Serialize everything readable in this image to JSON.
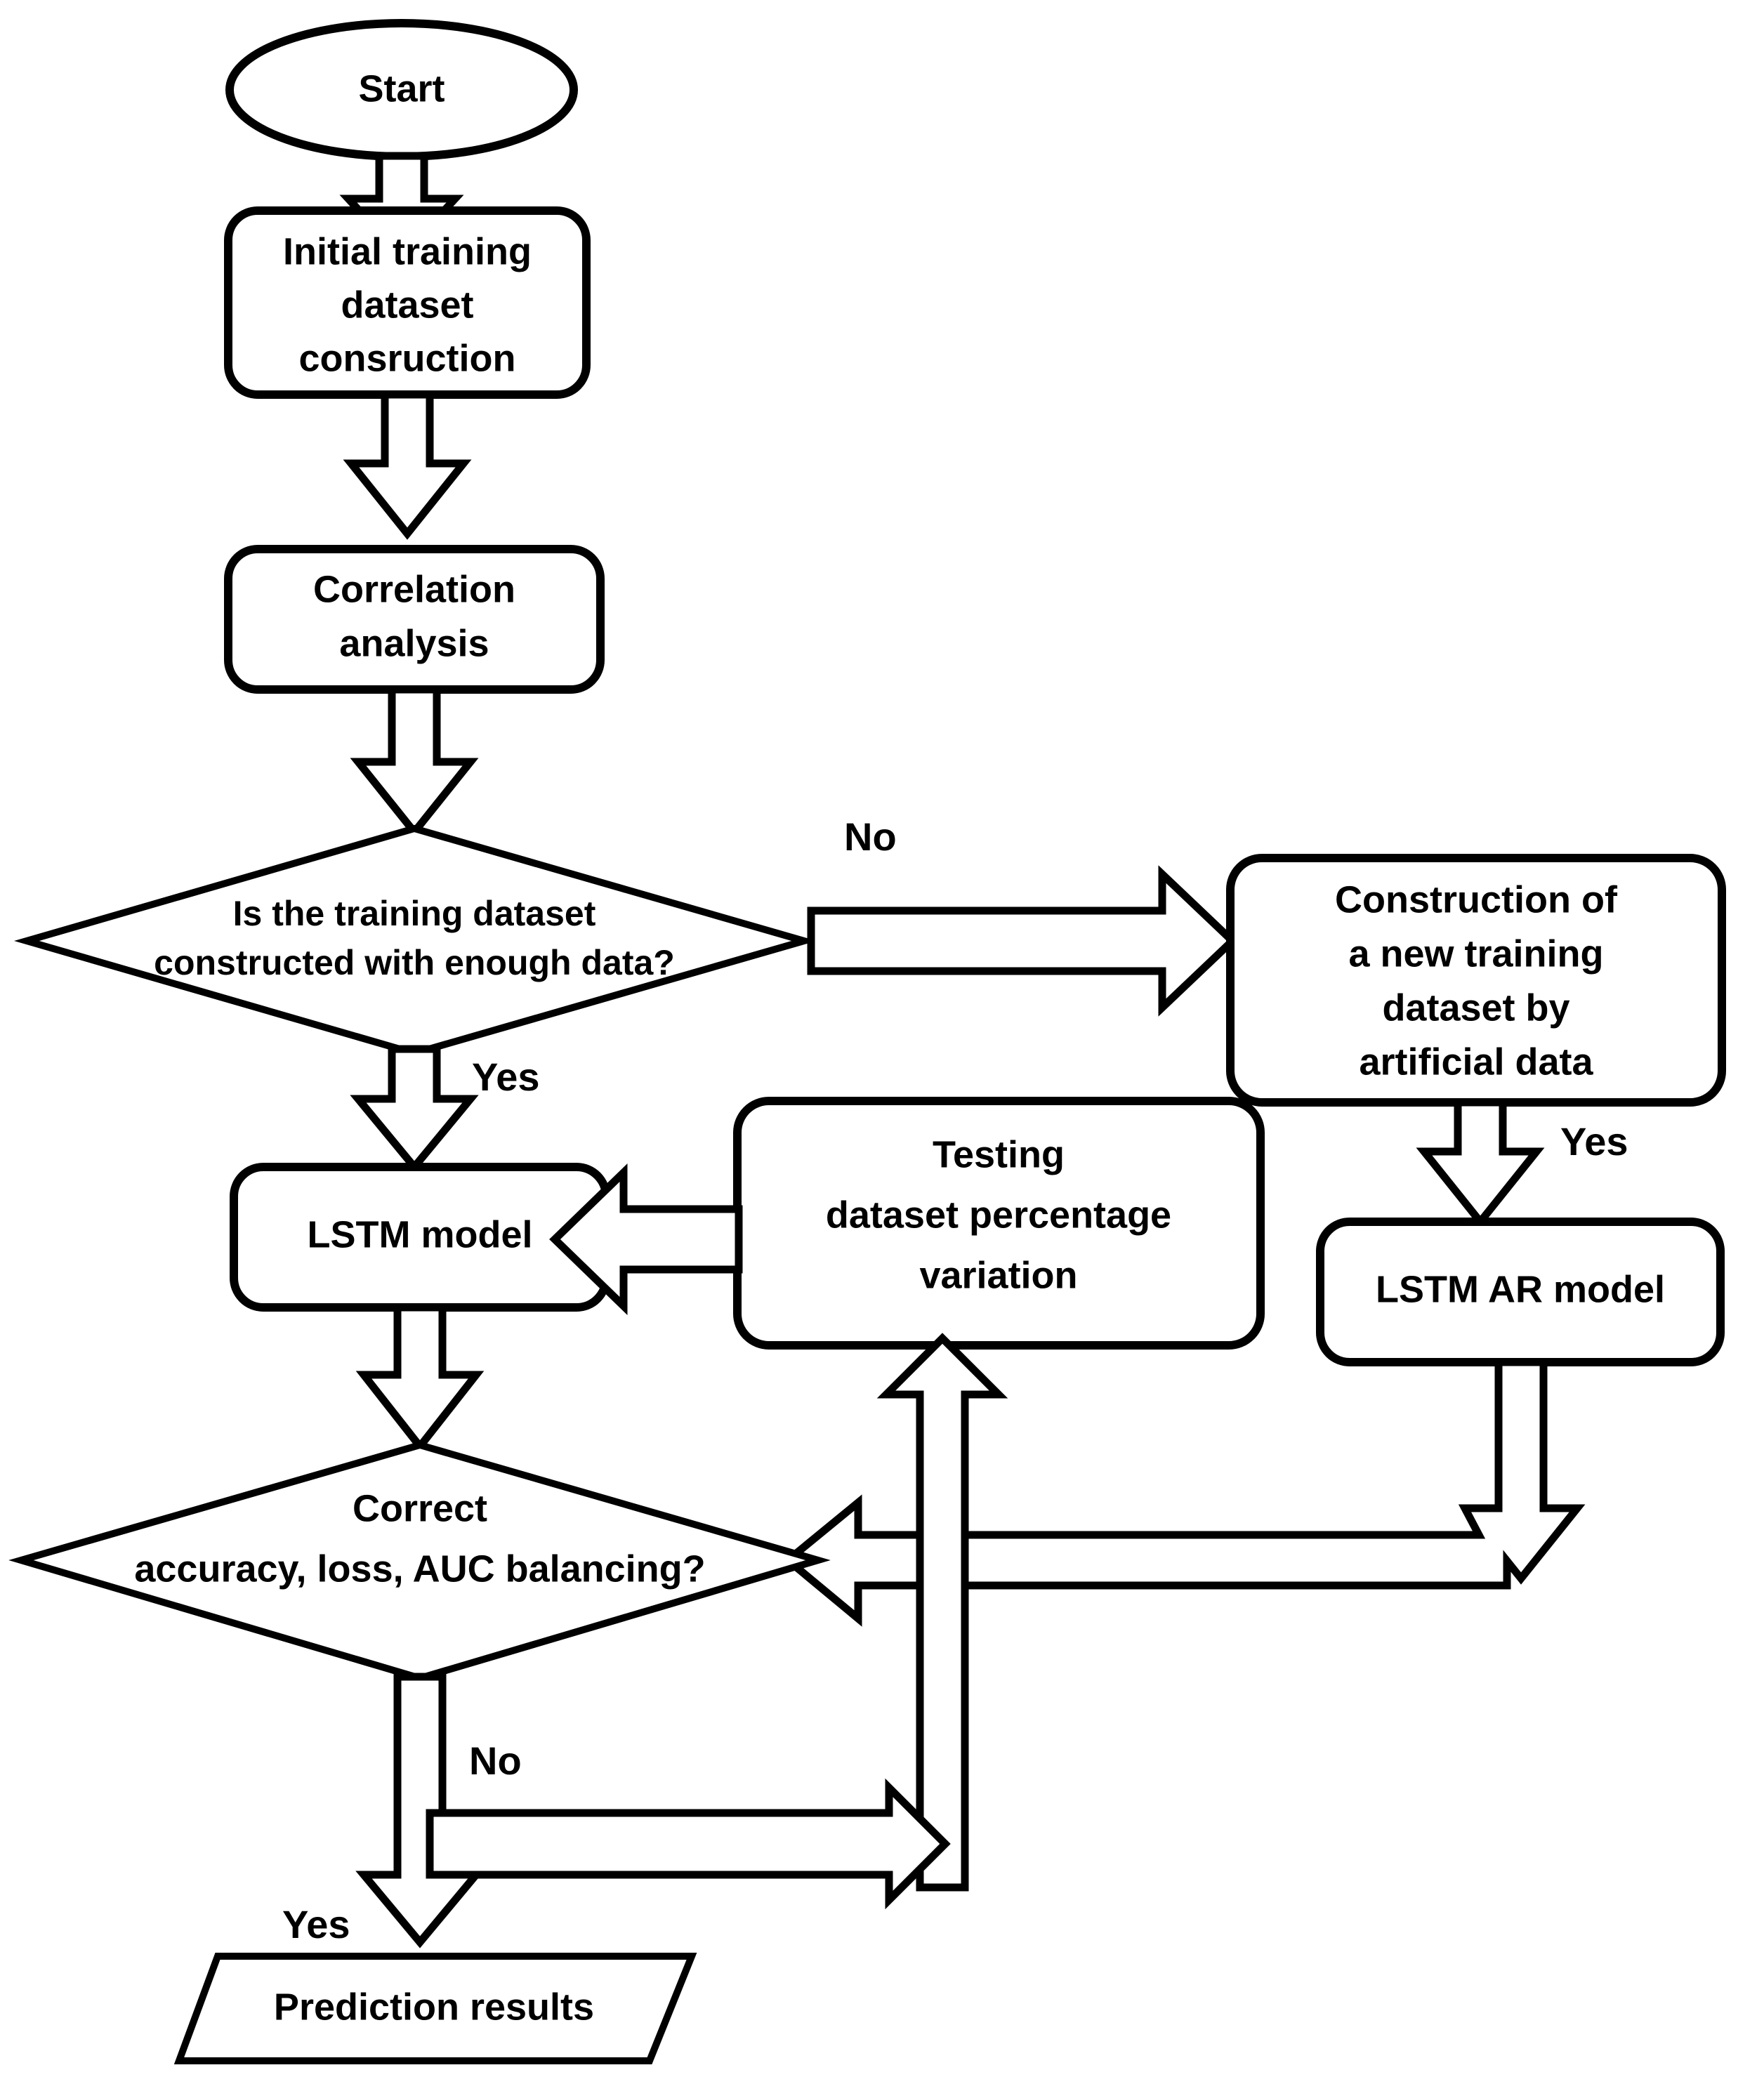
{
  "diagram": {
    "title": "LSTM prediction workflow flowchart",
    "background_color": "#ffffff",
    "line_color": "#000000",
    "fill_color": "#ffffff"
  },
  "nodes": {
    "start": {
      "shape": "ellipse",
      "label": "Start"
    },
    "initial_dataset": {
      "shape": "rounded-rect",
      "line1": "Initial training",
      "line2": "dataset",
      "line3": "consruction"
    },
    "correlation": {
      "shape": "rounded-rect",
      "line1": "Correlation",
      "line2": "analysis"
    },
    "enough_data_decision": {
      "shape": "diamond",
      "line1": "Is the training dataset",
      "line2": "constructed with enough data?"
    },
    "artificial_construction": {
      "shape": "rounded-rect",
      "line1": "Construction of",
      "line2": "a new training",
      "line3": "dataset by",
      "line4": "artificial data"
    },
    "lstm_model": {
      "shape": "rounded-rect",
      "label": "LSTM model"
    },
    "testing_variation": {
      "shape": "rounded-rect",
      "line1": "Testing",
      "line2": "dataset percentage",
      "line3": "variation"
    },
    "lstm_ar_model": {
      "shape": "rounded-rect",
      "label": "LSTM AR model"
    },
    "balance_decision": {
      "shape": "diamond",
      "line1": "Correct",
      "line2": "accuracy, loss, AUC balancing?"
    },
    "prediction_results": {
      "shape": "parallelogram",
      "label": "Prediction results"
    }
  },
  "edge_labels": {
    "no_to_artificial": "No",
    "yes_to_lstm": "Yes",
    "yes_to_lstm_ar": "Yes",
    "no_from_balance": "No",
    "yes_to_prediction": "Yes"
  }
}
